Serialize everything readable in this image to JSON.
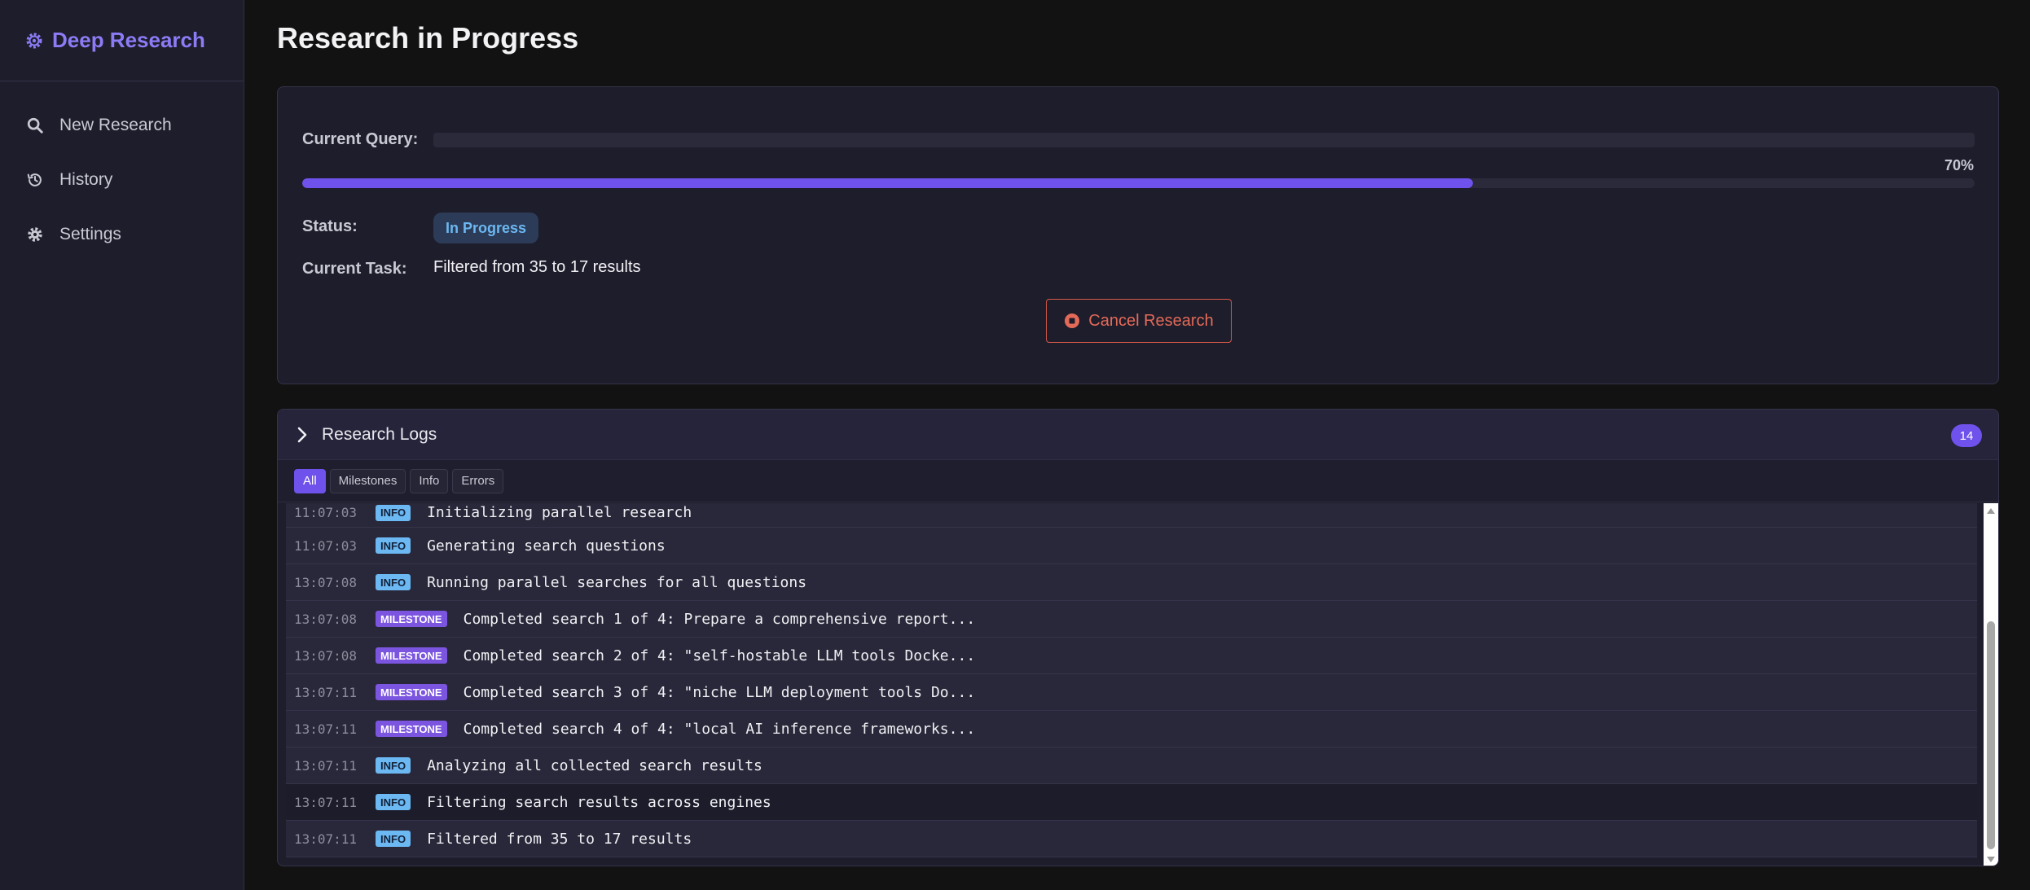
{
  "sidebar": {
    "brand": "Deep Research",
    "items": [
      {
        "label": "New Research",
        "icon": "search-icon"
      },
      {
        "label": "History",
        "icon": "history-icon"
      },
      {
        "label": "Settings",
        "icon": "gear-icon"
      }
    ]
  },
  "page": {
    "title": "Research in Progress"
  },
  "progress_card": {
    "query_label": "Current Query:",
    "query_value": "",
    "progress_percent": 70,
    "progress_text": "70%",
    "status_label": "Status:",
    "status_value": "In Progress",
    "task_label": "Current Task:",
    "task_value": "Filtered from 35 to 17 results",
    "cancel_label": "Cancel Research"
  },
  "logs": {
    "title": "Research Logs",
    "count": "14",
    "filters": [
      "All",
      "Milestones",
      "Info",
      "Errors"
    ],
    "active_filter": "All",
    "entries": [
      {
        "time": "11:07:03",
        "level": "INFO",
        "message": "Initializing parallel research"
      },
      {
        "time": "11:07:03",
        "level": "INFO",
        "message": "Generating search questions"
      },
      {
        "time": "13:07:08",
        "level": "INFO",
        "message": "Running parallel searches for all questions"
      },
      {
        "time": "13:07:08",
        "level": "MILESTONE",
        "message": "Completed search 1 of 4: Prepare a comprehensive report..."
      },
      {
        "time": "13:07:08",
        "level": "MILESTONE",
        "message": "Completed search 2 of 4: \"self-hostable LLM tools Docke..."
      },
      {
        "time": "13:07:11",
        "level": "MILESTONE",
        "message": "Completed search 3 of 4: \"niche LLM deployment tools Do..."
      },
      {
        "time": "13:07:11",
        "level": "MILESTONE",
        "message": "Completed search 4 of 4: \"local AI inference frameworks..."
      },
      {
        "time": "13:07:11",
        "level": "INFO",
        "message": "Analyzing all collected search results"
      },
      {
        "time": "13:07:11",
        "level": "INFO",
        "message": "Filtering search results across engines"
      },
      {
        "time": "13:07:11",
        "level": "INFO",
        "message": "Filtered from 35 to 17 results"
      }
    ]
  },
  "colors": {
    "accent": "#6f52ec",
    "info": "#6bb8f2",
    "milestone": "#7b55e0",
    "danger": "#e36a58"
  }
}
